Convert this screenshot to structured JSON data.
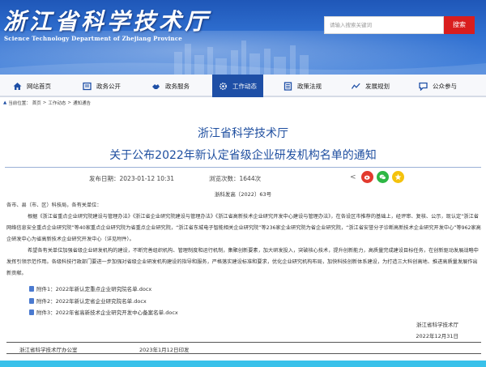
{
  "header": {
    "logo_cn": "浙江省科学技术厅",
    "logo_en": "Science Technology Department of Zhejiang Province",
    "search_placeholder": "请输入搜索关键词",
    "search_button": "搜索"
  },
  "nav": {
    "items": [
      {
        "label": "网站首页",
        "icon": "home-icon"
      },
      {
        "label": "政务公开",
        "icon": "document-icon"
      },
      {
        "label": "政务服务",
        "icon": "handshake-icon"
      },
      {
        "label": "工作动态",
        "icon": "gear-icon"
      },
      {
        "label": "政策法规",
        "icon": "list-icon"
      },
      {
        "label": "发展规划",
        "icon": "trend-icon"
      },
      {
        "label": "公众参与",
        "icon": "chat-icon"
      }
    ],
    "active_index": 3
  },
  "breadcrumb": {
    "prefix": "当前位置：",
    "items": [
      "首页",
      "工作动态",
      "通知通告"
    ],
    "separator": ">"
  },
  "article": {
    "org_title": "浙江省科学技术厅",
    "title": "关于公布2022年新认定省级企业研发机构名单的通知",
    "publish_date": "发布日期：2023-01-12 10:31",
    "views": "浏览次数：1644次",
    "doc_no": "浙科发高〔2022〕63号",
    "salutation": "各市、县（市、区）科技局，各有关单位：",
    "para1": "根据《浙江省重点企业研究院建设与管理办法》《浙江省企业研究院建设与管理办法》《浙江省高新技术企业研究开发中心建设与管理办法》，在各设区市推荐的基础上，经评审、复核、公示，现认定“浙江省网络信息安全重点企业研究院”等40家重点企业研究院为省重点企业研究院，“浙江省东城电子智能相关企业研究院”等236家企业研究院为省企业研究院，“浙江省安誉分子诊断高新技术企业研究开发中心”等962家高企研发中心为省高新技术企业研究开发中心（详见附件）。",
    "para2": "希望各有关单位加强省级企业研发机构的建设，不断完善组织机构、管理制度和运行机制，集聚创新要素，加大研发投入，突破核心技术，提升创新能力，高质量完成建设目标任务，在创新驱动发展战略中发挥引领示范作用。各级科技行政部门要进一步加强对省级企业研发机构建设的指导和服务，严格落实建设标准和要求，优化企业研究机构布局，加快科技创新体系建设，为打造三大科创高地、推进高质量发展作出新贡献。",
    "attachments": [
      "附件1：2022年新认定重点企业研究院名单.docx",
      "附件2：2022年新认定省企业研究院名单.docx",
      "附件3：2022年省高新技术企业研究开发中心备案名单.docx"
    ],
    "signature_org": "浙江省科学技术厅",
    "signature_date": "2022年12月31日"
  },
  "footer": {
    "office": "浙江省科学技术厅办公室",
    "print_date": "2023年1月12日印发"
  },
  "colors": {
    "brand_blue": "#1f4fa0",
    "nav_active": "#1e4fa6",
    "search_red": "#d91e1e",
    "bottom_bar": "#39c1ea"
  }
}
